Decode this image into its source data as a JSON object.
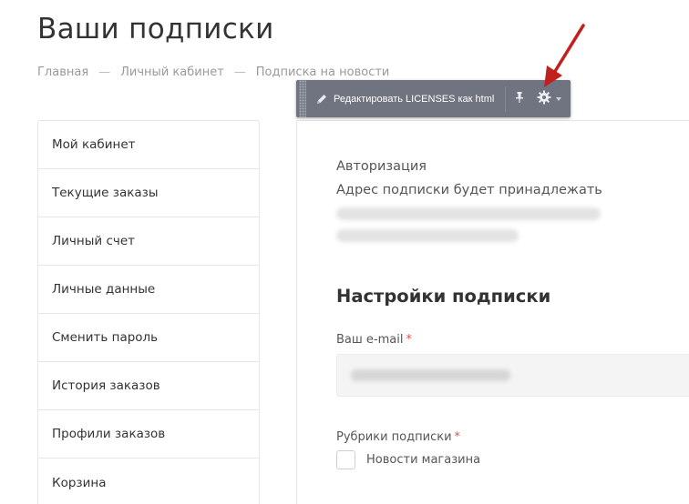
{
  "page": {
    "title": "Ваши подписки"
  },
  "breadcrumb": {
    "items": [
      "Главная",
      "Личный кабинет",
      "Подписка на новости"
    ],
    "separator": "—"
  },
  "sidebar": {
    "items": [
      {
        "label": "Мой кабинет"
      },
      {
        "label": "Текущие заказы"
      },
      {
        "label": "Личный счет"
      },
      {
        "label": "Личные данные"
      },
      {
        "label": "Сменить пароль"
      },
      {
        "label": "История заказов"
      },
      {
        "label": "Профили заказов"
      },
      {
        "label": "Корзина"
      }
    ]
  },
  "admin_toolbar": {
    "edit_label": "Редактировать LICENSES как html",
    "icons": [
      "pencil-icon",
      "pin-icon",
      "gear-icon",
      "caret-down-icon"
    ]
  },
  "auth": {
    "title": "Авторизация",
    "description": "Адрес подписки будет принадлежать"
  },
  "subscription_settings": {
    "title": "Настройки подписки",
    "email_label": "Ваш e-mail",
    "required_mark": "*",
    "rubrics_label": "Рубрики подписки",
    "rubric_options": [
      {
        "label": "Новости магазина",
        "checked": false
      }
    ]
  },
  "colors": {
    "toolbar_bg": "#6f7480",
    "required": "#d9534f",
    "annotation_arrow": "#c0201e",
    "border": "#e6e6e6"
  }
}
